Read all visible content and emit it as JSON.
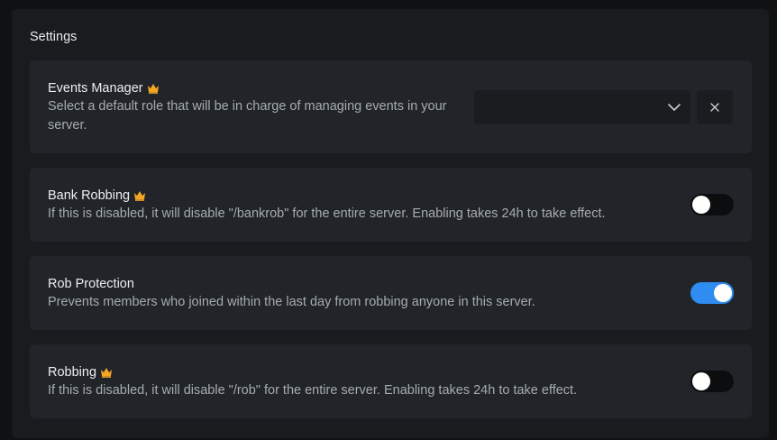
{
  "panel": {
    "title": "Settings"
  },
  "settings": [
    {
      "title": "Events Manager",
      "premium": true,
      "description": "Select a default role that will be in charge of managing events in your server.",
      "control": "select",
      "selected_value": ""
    },
    {
      "title": "Bank Robbing",
      "premium": true,
      "description": "If this is disabled, it will disable \"/bankrob\" for the entire server. Enabling takes 24h to take effect.",
      "control": "toggle",
      "enabled": false
    },
    {
      "title": "Rob Protection",
      "premium": false,
      "description": "Prevents members who joined within the last day from robbing anyone in this server.",
      "control": "toggle",
      "enabled": true
    },
    {
      "title": "Robbing",
      "premium": true,
      "description": "If this is disabled, it will disable \"/rob\" for the entire server. Enabling takes 24h to take effect.",
      "control": "toggle",
      "enabled": false
    }
  ],
  "colors": {
    "accent": "#2f8cf0",
    "crown": "#f5a623",
    "card_bg": "#212529",
    "panel_bg": "#181c1f"
  }
}
